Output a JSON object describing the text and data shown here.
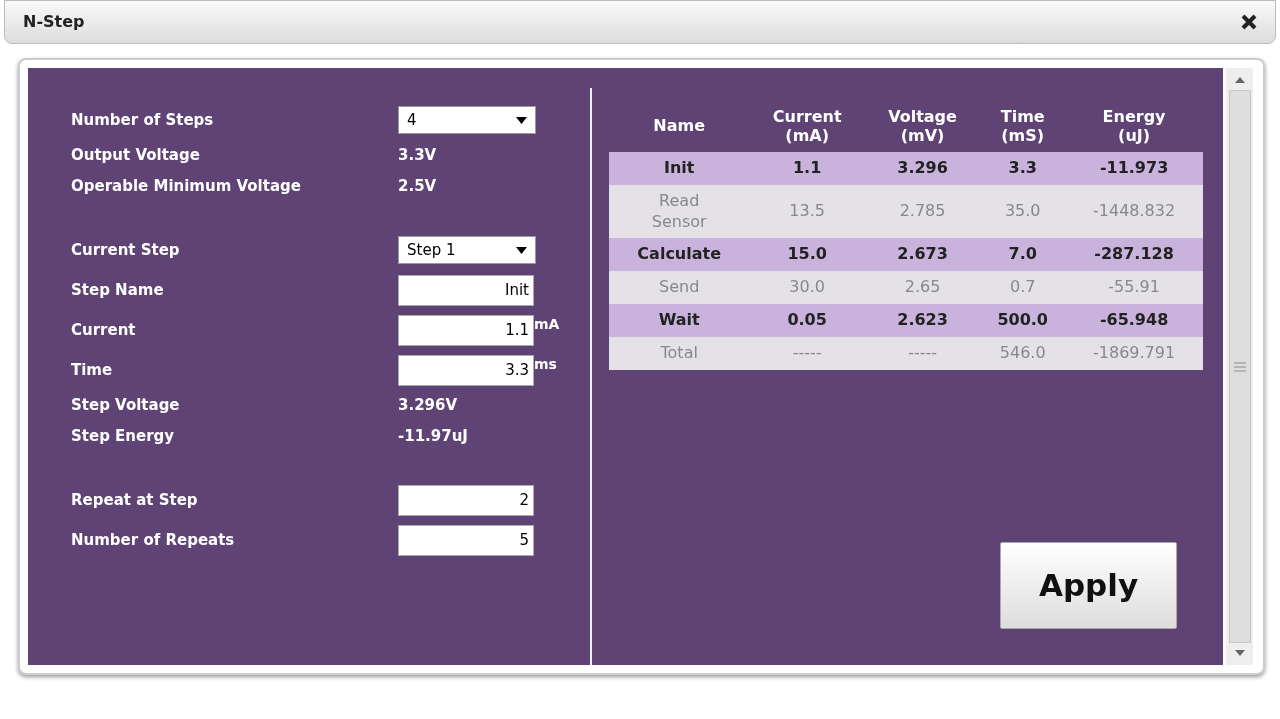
{
  "window": {
    "title": "N-Step"
  },
  "settings": [
    [
      {
        "kind": "select",
        "label": "Number of Steps",
        "value": "4"
      },
      {
        "kind": "text",
        "label": "Output Voltage",
        "value": "3.3V"
      },
      {
        "kind": "text",
        "label": "Operable Minimum Voltage",
        "value": "2.5V"
      }
    ],
    [
      {
        "kind": "select",
        "label": "Current Step",
        "value": "Step 1"
      },
      {
        "kind": "input",
        "label": "Step Name",
        "value": "Init"
      },
      {
        "kind": "input",
        "label": "Current",
        "value": "1.1",
        "unit": "mA"
      },
      {
        "kind": "input",
        "label": "Time",
        "value": "3.3",
        "unit": "ms"
      },
      {
        "kind": "text",
        "label": "Step Voltage",
        "value": "3.296V"
      },
      {
        "kind": "text",
        "label": "Step Energy",
        "value": "-11.97uJ"
      }
    ],
    [
      {
        "kind": "input",
        "label": "Repeat at Step",
        "value": "2"
      },
      {
        "kind": "input",
        "label": "Number of Repeats",
        "value": "5"
      }
    ]
  ],
  "table": {
    "columns": [
      "Name",
      "Current\n(mA)",
      "Voltage\n(mV)",
      "Time\n(mS)",
      "Energy\n(uJ)"
    ],
    "rows": [
      {
        "highlighted": true,
        "cells": [
          "Init",
          "1.1",
          "3.296",
          "3.3",
          "-11.973"
        ]
      },
      {
        "highlighted": false,
        "cells": [
          "Read\nSensor",
          "13.5",
          "2.785",
          "35.0",
          "-1448.832"
        ]
      },
      {
        "highlighted": true,
        "cells": [
          "Calculate",
          "15.0",
          "2.673",
          "7.0",
          "-287.128"
        ]
      },
      {
        "highlighted": false,
        "cells": [
          "Send",
          "30.0",
          "2.65",
          "0.7",
          "-55.91"
        ]
      },
      {
        "highlighted": true,
        "cells": [
          "Wait",
          "0.05",
          "2.623",
          "500.0",
          "-65.948"
        ]
      },
      {
        "highlighted": false,
        "cells": [
          "Total",
          "-----",
          "-----",
          "546.0",
          "-1869.791"
        ]
      }
    ]
  },
  "apply_button": "Apply"
}
